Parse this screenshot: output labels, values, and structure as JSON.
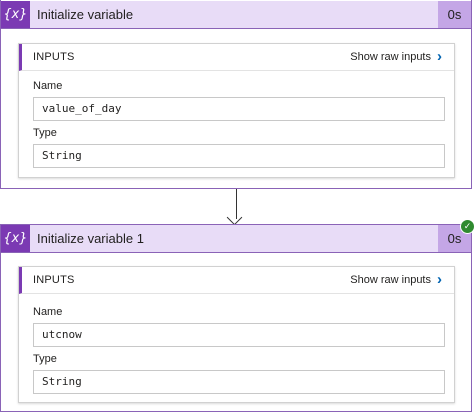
{
  "cards": [
    {
      "icon": "{x}",
      "title": "Initialize variable",
      "duration": "0s",
      "inputs_label": "INPUTS",
      "show_raw": "Show raw inputs",
      "fields": [
        {
          "label": "Name",
          "value": "value_of_day"
        },
        {
          "label": "Type",
          "value": "String"
        }
      ]
    },
    {
      "icon": "{x}",
      "title": "Initialize variable 1",
      "duration": "0s",
      "inputs_label": "INPUTS",
      "show_raw": "Show raw inputs",
      "fields": [
        {
          "label": "Name",
          "value": "utcnow"
        },
        {
          "label": "Type",
          "value": "String"
        }
      ]
    }
  ],
  "icons": {
    "variable": "variable-icon",
    "chevron": "chevron-right-icon",
    "success": "check-circle-icon",
    "connector": "arrow-down-icon"
  },
  "colors": {
    "accent": "#7b3ab3",
    "header_bg": "#e8dcf7",
    "link": "#0063b1",
    "success": "#2f8a2f"
  }
}
